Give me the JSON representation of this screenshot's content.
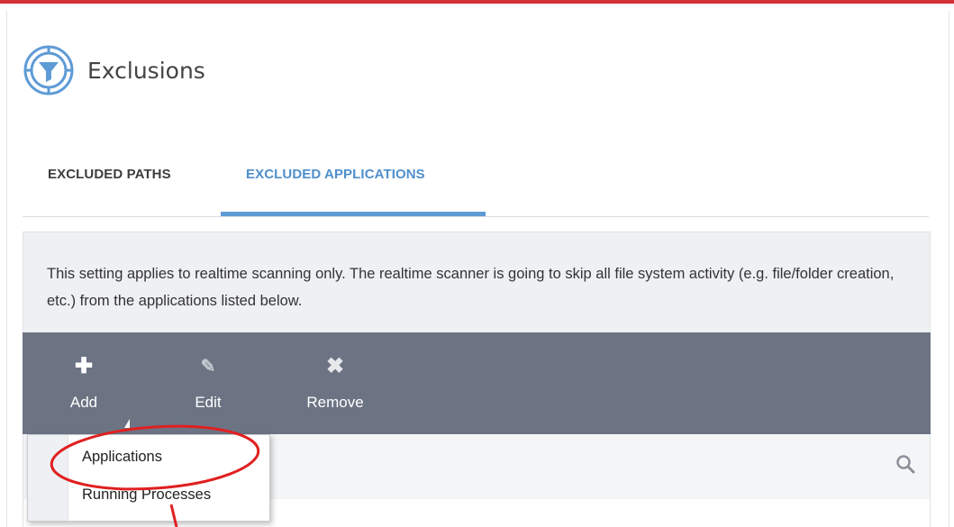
{
  "colors": {
    "accent_blue": "#5e9bd6",
    "toolbar_bg": "#6c7484",
    "annotation_red": "#e02020",
    "top_bar_red": "#d32f36"
  },
  "header": {
    "icon": "exclusions-filter-icon",
    "title": "Exclusions"
  },
  "tabs": [
    {
      "label": "EXCLUDED PATHS",
      "active": false
    },
    {
      "label": "EXCLUDED APPLICATIONS",
      "active": true
    }
  ],
  "info": {
    "text": "This setting applies to realtime scanning only. The realtime scanner is going to skip all file system activity (e.g. file/folder creation, etc.) from the applications listed below."
  },
  "toolbar": {
    "add_label": "Add",
    "edit_label": "Edit",
    "remove_label": "Remove",
    "add_icon": "plus-icon",
    "edit_icon": "pencil-icon",
    "remove_icon": "x-icon"
  },
  "dropdown": {
    "items": [
      "Applications",
      "Running Processes"
    ]
  },
  "list": {
    "search_icon": "search-icon"
  }
}
